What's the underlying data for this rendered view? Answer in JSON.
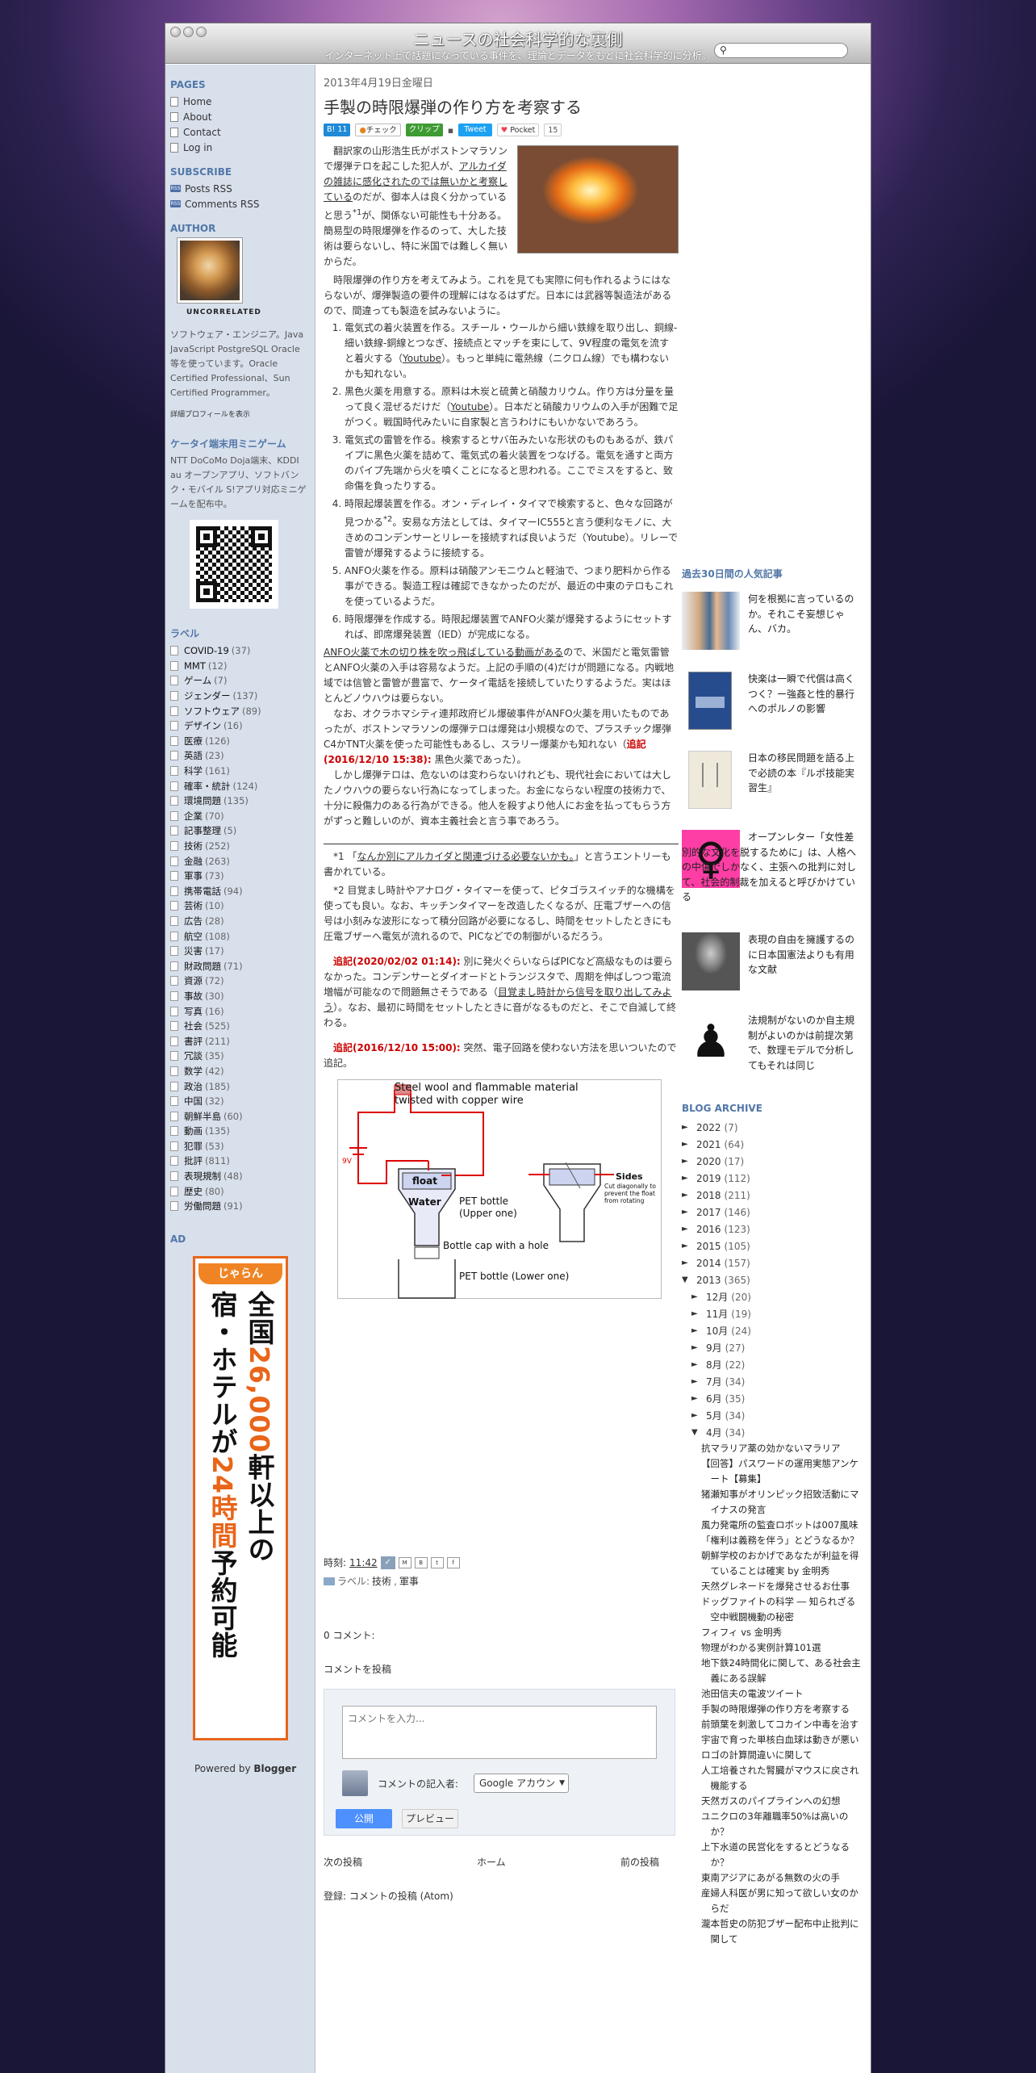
{
  "blog": {
    "title": "ニュースの社会科学的な裏側",
    "description": "インターネット上で話題になっている事件を、理論とデータをもとに社会科学的に分析。",
    "search_placeholder": ""
  },
  "sidebar": {
    "pages_heading": "PAGES",
    "pages": [
      "Home",
      "About",
      "Contact",
      "Log in"
    ],
    "subscribe_heading": "SUBSCRIBE",
    "subscribe": [
      "Posts RSS",
      "Comments RSS"
    ],
    "author_heading": "AUTHOR",
    "author_name": "UNCORRELATED",
    "author_bio": "ソフトウェア・エンジニア。Java JavaScript PostgreSQL Oracle 等を使っています。Oracle Certified Professional、Sun Certified Programmer。",
    "profile_link": "詳細プロフィールを表示",
    "game_heading": "ケータイ端末用ミニゲーム",
    "game_text": "NTT DoCoMo Doja端末、KDDI au オープンアプリ、ソフトバンク・モバイル S!アプリ対応ミニゲームを配布中。",
    "labels_heading": "ラベル",
    "labels": [
      {
        "name": "COVID-19",
        "count": "(37)"
      },
      {
        "name": "MMT",
        "count": "(12)"
      },
      {
        "name": "ゲーム",
        "count": "(7)"
      },
      {
        "name": "ジェンダー",
        "count": "(137)"
      },
      {
        "name": "ソフトウェア",
        "count": "(89)"
      },
      {
        "name": "デザイン",
        "count": "(16)"
      },
      {
        "name": "医療",
        "count": "(126)"
      },
      {
        "name": "英語",
        "count": "(23)"
      },
      {
        "name": "科学",
        "count": "(161)"
      },
      {
        "name": "確率・統計",
        "count": "(124)"
      },
      {
        "name": "環境問題",
        "count": "(135)"
      },
      {
        "name": "企業",
        "count": "(70)"
      },
      {
        "name": "記事整理",
        "count": "(5)"
      },
      {
        "name": "技術",
        "count": "(252)"
      },
      {
        "name": "金融",
        "count": "(263)"
      },
      {
        "name": "軍事",
        "count": "(73)"
      },
      {
        "name": "携帯電話",
        "count": "(94)"
      },
      {
        "name": "芸術",
        "count": "(10)"
      },
      {
        "name": "広告",
        "count": "(28)"
      },
      {
        "name": "航空",
        "count": "(108)"
      },
      {
        "name": "災害",
        "count": "(17)"
      },
      {
        "name": "財政問題",
        "count": "(71)"
      },
      {
        "name": "資源",
        "count": "(72)"
      },
      {
        "name": "事故",
        "count": "(30)"
      },
      {
        "name": "写真",
        "count": "(16)"
      },
      {
        "name": "社会",
        "count": "(525)"
      },
      {
        "name": "書評",
        "count": "(211)"
      },
      {
        "name": "冗談",
        "count": "(35)"
      },
      {
        "name": "数学",
        "count": "(42)"
      },
      {
        "name": "政治",
        "count": "(185)"
      },
      {
        "name": "中国",
        "count": "(32)"
      },
      {
        "name": "朝鮮半島",
        "count": "(60)"
      },
      {
        "name": "動画",
        "count": "(135)"
      },
      {
        "name": "犯罪",
        "count": "(53)"
      },
      {
        "name": "批評",
        "count": "(811)"
      },
      {
        "name": "表現規制",
        "count": "(48)"
      },
      {
        "name": "歴史",
        "count": "(80)"
      },
      {
        "name": "労働問題",
        "count": "(91)"
      }
    ],
    "ad_heading": "AD",
    "ad_badge": "じゃらん",
    "ad_line1": "全国",
    "ad_number": "26,000",
    "ad_line1b": "軒以上の",
    "ad_line2": "宿・ホテルが",
    "ad_hours": "24時間",
    "ad_line2b": "予約可能",
    "powered_prefix": "Powered by ",
    "powered_link": "Blogger"
  },
  "post": {
    "date": "2013年4月19日金曜日",
    "title": "手製の時限爆弾の作り方を考察する",
    "share": {
      "hatena": "B! 11",
      "check": "チェック",
      "clip": "クリップ",
      "tweet": "Tweet",
      "pocket": "Pocket",
      "pocket_count": "15"
    },
    "p1a": "翻訳家の山形浩生氏がボストンマラソンで爆弾テロを起こした犯人が、",
    "p1link": "アルカイダの雑誌に感化されたのでは無いかと考察している",
    "p1b": "のだが、御本人は良く分かっていると思う",
    "p1sup": "*1",
    "p1c": "が、関係ない可能性も十分ある。簡易型の時限爆弾を作るのって、大した技術は要らないし、特に米国では難しく無いからだ。",
    "p2": "時限爆弾の作り方を考えてみよう。これを見ても実際に何も作れるようにはならないが、爆弾製造の要件の理解にはなるはずだ。日本には武器等製造法があるので、間違っても製造を試みないように。",
    "steps": [
      {
        "a": "電気式の着火装置を作る。スチール・ウールから細い鉄線を取り出し、銅線-細い鉄線-銅線とつなぎ、接続点とマッチを束にして、9V程度の電気を流すと着火する（",
        "link": "Youtube",
        "b": "）。もっと単純に電熱線（ニクロム線）でも構わないかも知れない。"
      },
      {
        "a": "黒色火薬を用意する。原料は木炭と硫黄と硝酸カリウム。作り方は分量を量って良く混ぜるだけだ（",
        "link": "Youtube",
        "b": "）。日本だと硝酸カリウムの入手が困難で足がつく。戦国時代みたいに自家製と言うわけにもいかないであろう。"
      },
      {
        "a": "電気式の雷管を作る。検索するとサバ缶みたいな形状のものもあるが、鉄パイプに黒色火薬を詰めて、電気式の着火装置をつなげる。電気を通すと両方のパイプ先端から火を噴くことになると思われる。ここでミスをすると、致命傷を負ったりする。",
        "link": "",
        "b": ""
      },
      {
        "a": "時限起爆装置を作る。オン・ディレイ・タイマで検索すると、色々な回路が見つかる",
        "link": "",
        "sup": "*2",
        "b": "。安易な方法としては、タイマーIC555と言う便利なモノに、大きめのコンデンサーとリレーを接続すれば良いようだ（Youtube）。リレーで雷管が爆発するように接続する。"
      },
      {
        "a": "ANFO火薬を作る。原料は硝酸アンモニウムと軽油で、つまり肥料から作る事ができる。製造工程は確認できなかったのだが、最近の中東のテロもこれを使っているようだ。",
        "link": "",
        "b": ""
      },
      {
        "a": "時限爆弾を作成する。時限起爆装置でANFO火薬が爆発するようにセットすれば、即席爆発装置（IED）が完成になる。",
        "link": "",
        "b": ""
      }
    ],
    "p3link": "ANFO火薬で木の切り株を吹っ飛ばしている動画がある",
    "p3a": "ので、米国だと電気雷管とANFO火薬の入手は容易なようだ。上記の手順の(4)だけが問題になる。内戦地域では信管と雷管が豊富で、ケータイ電話を接続していたりするようだ。実はほとんどノウハウは要らない。",
    "p4a": "なお、オクラホマシティ連邦政府ビル爆破事件がANFO火薬を用いたものであったが、ボストンマラソンの爆弾テロは爆発は小規模なので、プラスチック爆弾C4かTNT火薬を使った可能性もあるし、スラリー爆薬かも知れない（",
    "p4red": "追記(2016/12/10 15:38):",
    "p4b": " 黒色火薬であった）。",
    "p5": "しかし爆弾テロは、危ないのは変わらないけれども、現代社会においては大したノウハウの要らない行為になってしまった。お金にならない程度の技術力で、十分に殺傷力のある行為ができる。他人を殺すより他人にお金を払ってもらう方がずっと難しいのが、資本主義社会と言う事であろう。",
    "fn1a": "*1 「",
    "fn1link": "なんか別にアルカイダと関連づける必要ないかも。",
    "fn1b": "」と言うエントリーも書かれている。",
    "fn2": "*2 目覚まし時計やアナログ・タイマーを使って、ピタゴラスイッチ的な機構を使っても良い。なお、キッチンタイマーを改造したくなるが、圧電ブザーへの信号は小刻みな波形になって積分回路が必要になるし、時間をセットしたときにも圧電ブザーへ電気が流れるので、PICなどでの制御がいるだろう。",
    "u1red": "追記(2020/02/02 01:14):",
    "u1a": " 別に発火ぐらいならばPICなど高級なものは要らなかった。コンデンサーとダイオードとトランジスタで、周期を伸ばしつつ電流増幅が可能なので問題無さそうである（",
    "u1link": "目覚まし時計から信号を取り出してみよう",
    "u1b": "）。なお、最初に時間をセットしたときに音がなるものだと、そこで自滅して終わる。",
    "u2red": "追記(2016/12/10 15:00):",
    "u2a": " 突然、電子回路を使わない方法を思いついたので追記。",
    "diagram": {
      "steel": "Steel wool and flammable material",
      "twisted": "twisted with copper wire",
      "volt": "9V",
      "float": "float",
      "water": "Water",
      "pet_upper": "PET bottle",
      "pet_upper2": "(Upper one)",
      "cap": "Bottle cap with a hole",
      "pet_lower": "PET bottle (Lower one)",
      "sides": "Sides",
      "sides_note": "Cut diagonally to prevent the float from rotating"
    },
    "time_label": "時刻:",
    "time_value": "11:42",
    "labels_prefix": "ラベル:",
    "labels_value": "技術",
    "labels_value2": "軍事",
    "comments_count": "0 コメント:",
    "comment_heading": "コメントを投稿",
    "comment_placeholder": "コメントを入力...",
    "commenter_label": "コメントの記入者:",
    "commenter_select": "Google アカウン",
    "publish": "公開",
    "preview": "プレビュー",
    "next_post": "次の投稿",
    "home": "ホーム",
    "prev_post": "前の投稿",
    "subscribe_label": "登録: ",
    "subscribe_link": "コメントの投稿 (Atom)"
  },
  "right": {
    "popular_heading": "過去30日間の人気記事",
    "popular": [
      "何を根拠に言っているのか。それこそ妄想じゃん、バカ。",
      "快楽は一瞬で代償は高くつく？ー強姦と性的暴行へのポルノの影響",
      "日本の移民問題を語る上で必読の本『ルポ技能実習生』",
      "オープンレター「女性差別的な文化を脱するために」は、人格への中傷でしかなく、主張への批判に対して、社会的制裁を加えると呼びかけている",
      "表現の自由を擁護するのに日本国憲法よりも有用な文献",
      "法規制がないのか自主規制がよいのかは前提次第で、数理モデルで分析してもそれは同じ"
    ],
    "archive_heading": "BLOG ARCHIVE",
    "years": [
      {
        "y": "2022",
        "c": "(7)"
      },
      {
        "y": "2021",
        "c": "(64)"
      },
      {
        "y": "2020",
        "c": "(17)"
      },
      {
        "y": "2019",
        "c": "(112)"
      },
      {
        "y": "2018",
        "c": "(211)"
      },
      {
        "y": "2017",
        "c": "(146)"
      },
      {
        "y": "2016",
        "c": "(123)"
      },
      {
        "y": "2015",
        "c": "(105)"
      },
      {
        "y": "2014",
        "c": "(157)"
      }
    ],
    "open_year": {
      "y": "2013",
      "c": "(365)"
    },
    "months": [
      {
        "m": "12月",
        "c": "(20)"
      },
      {
        "m": "11月",
        "c": "(19)"
      },
      {
        "m": "10月",
        "c": "(24)"
      },
      {
        "m": "9月",
        "c": "(27)"
      },
      {
        "m": "8月",
        "c": "(22)"
      },
      {
        "m": "7月",
        "c": "(34)"
      },
      {
        "m": "6月",
        "c": "(35)"
      },
      {
        "m": "5月",
        "c": "(34)"
      }
    ],
    "open_month": {
      "m": "4月",
      "c": "(34)"
    },
    "april_posts": [
      "抗マラリア薬の効かないマラリア",
      "【回答】パスワードの運用実態アンケート【募集】",
      "猪瀬知事がオリンピック招致活動にマイナスの発言",
      "風力発電所の監査ロボットは007風味",
      "「権利は義務を伴う」とどうなるか？",
      "朝鮮学校のおかげであなたが利益を得ていることは確実 by 金明秀",
      "天然グレネードを爆発させるお仕事",
      "ドッグファイトの科学 ― 知られざる空中戦闘機動の秘密",
      "フィフィ vs 金明秀",
      "物理がわかる実例計算101選",
      "地下鉄24時間化に関して、ある社会主義にある誤解",
      "池田信夫の電波ツイート",
      "手製の時限爆弾の作り方を考察する",
      "前頭葉を刺激してコカイン中毒を治す",
      "宇宙で育った単核白血球は動きが悪い",
      "ロゴの計算間違いに関して",
      "人工培養された腎臓がマウスに戻され機能する",
      "天然ガスのパイプラインへの幻想",
      "ユニクロの3年離職率50%は高いのか？",
      "上下水道の民営化をするとどうなるか？",
      "東南アジアにあがる無数の火の手",
      "産婦人科医が男に知って欲しい女のからだ",
      "瀧本哲史の防犯ブザー配布中止批判に関して"
    ]
  }
}
